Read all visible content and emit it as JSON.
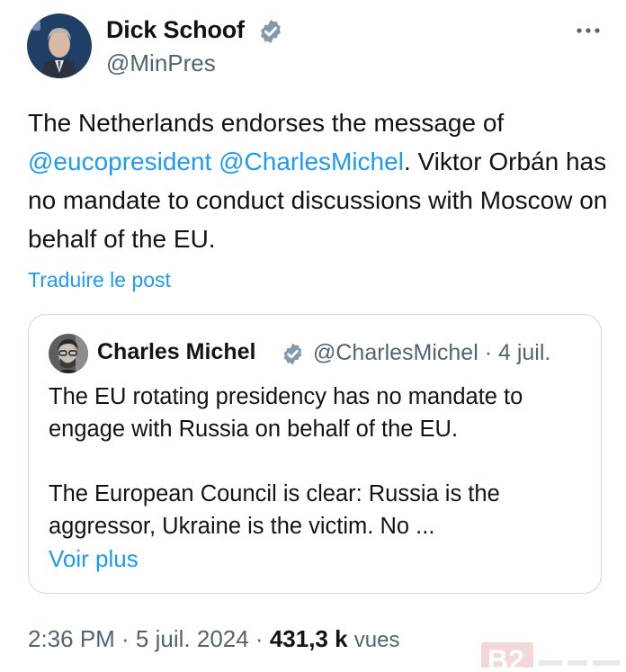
{
  "author": {
    "name": "Dick Schoof",
    "handle": "@MinPres",
    "verified": true
  },
  "more_icon": "more-horizontal-icon",
  "tweet": {
    "text_before": "The Netherlands endorses the message of",
    "mention1": "@eucopresident",
    "mention2": "@CharlesMichel",
    "text_after": ". Viktor Orbán has no mandate to conduct discussions with Moscow on behalf of the EU.",
    "translate_label": "Traduire le post"
  },
  "quote": {
    "name": "Charles Michel",
    "handle_date": "@CharlesMichel · 4 juil.",
    "verified": true,
    "paragraph1": "The EU rotating presidency has no mandate to engage with Russia on behalf of the EU.",
    "paragraph2": "The European Council is clear: Russia is the aggressor, Ukraine is the victim. No ...",
    "see_more_label": "Voir plus"
  },
  "meta": {
    "time_date": "2:36 PM · 5 juil. 2024 · ",
    "views_count": "431,3 k",
    "views_label": "vues"
  },
  "watermark": "B2",
  "colors": {
    "link": "#1d9bf0",
    "secondary_text": "#536471",
    "primary_text": "#0f1419",
    "border": "#cfd9de",
    "verified_badge": "#829aab"
  }
}
